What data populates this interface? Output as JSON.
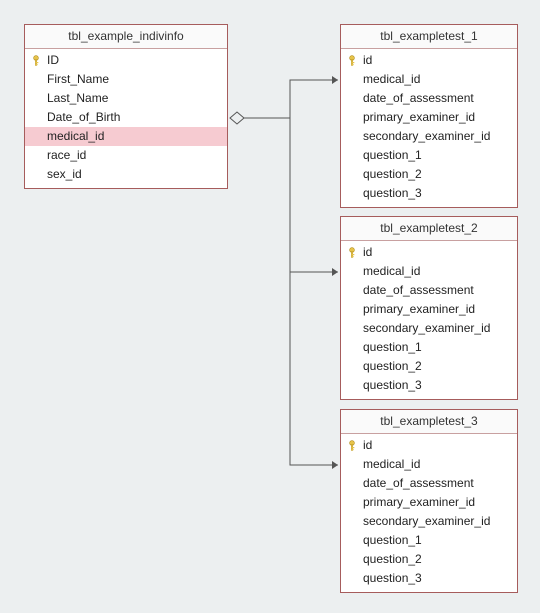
{
  "tables": {
    "source": {
      "title": "tbl_example_indivinfo",
      "fields": [
        {
          "name": "ID",
          "pk": true
        },
        {
          "name": "First_Name",
          "pk": false
        },
        {
          "name": "Last_Name",
          "pk": false
        },
        {
          "name": "Date_of_Birth",
          "pk": false
        },
        {
          "name": "medical_id",
          "pk": false,
          "highlight": true
        },
        {
          "name": "race_id",
          "pk": false
        },
        {
          "name": "sex_id",
          "pk": false
        }
      ]
    },
    "t1": {
      "title": "tbl_exampletest_1",
      "fields": [
        {
          "name": "id",
          "pk": true
        },
        {
          "name": "medical_id",
          "pk": false
        },
        {
          "name": "date_of_assessment",
          "pk": false
        },
        {
          "name": "primary_examiner_id",
          "pk": false
        },
        {
          "name": "secondary_examiner_id",
          "pk": false
        },
        {
          "name": "question_1",
          "pk": false
        },
        {
          "name": "question_2",
          "pk": false
        },
        {
          "name": "question_3",
          "pk": false
        }
      ]
    },
    "t2": {
      "title": "tbl_exampletest_2",
      "fields": [
        {
          "name": "id",
          "pk": true
        },
        {
          "name": "medical_id",
          "pk": false
        },
        {
          "name": "date_of_assessment",
          "pk": false
        },
        {
          "name": "primary_examiner_id",
          "pk": false
        },
        {
          "name": "secondary_examiner_id",
          "pk": false
        },
        {
          "name": "question_1",
          "pk": false
        },
        {
          "name": "question_2",
          "pk": false
        },
        {
          "name": "question_3",
          "pk": false
        }
      ]
    },
    "t3": {
      "title": "tbl_exampletest_3",
      "fields": [
        {
          "name": "id",
          "pk": true
        },
        {
          "name": "medical_id",
          "pk": false
        },
        {
          "name": "date_of_assessment",
          "pk": false
        },
        {
          "name": "primary_examiner_id",
          "pk": false
        },
        {
          "name": "secondary_examiner_id",
          "pk": false
        },
        {
          "name": "question_1",
          "pk": false
        },
        {
          "name": "question_2",
          "pk": false
        },
        {
          "name": "question_3",
          "pk": false
        }
      ]
    }
  },
  "relationships": [
    {
      "from": "source.medical_id",
      "to": "t1.medical_id"
    },
    {
      "from": "source.medical_id",
      "to": "t2.medical_id"
    },
    {
      "from": "source.medical_id",
      "to": "t3.medical_id"
    }
  ]
}
